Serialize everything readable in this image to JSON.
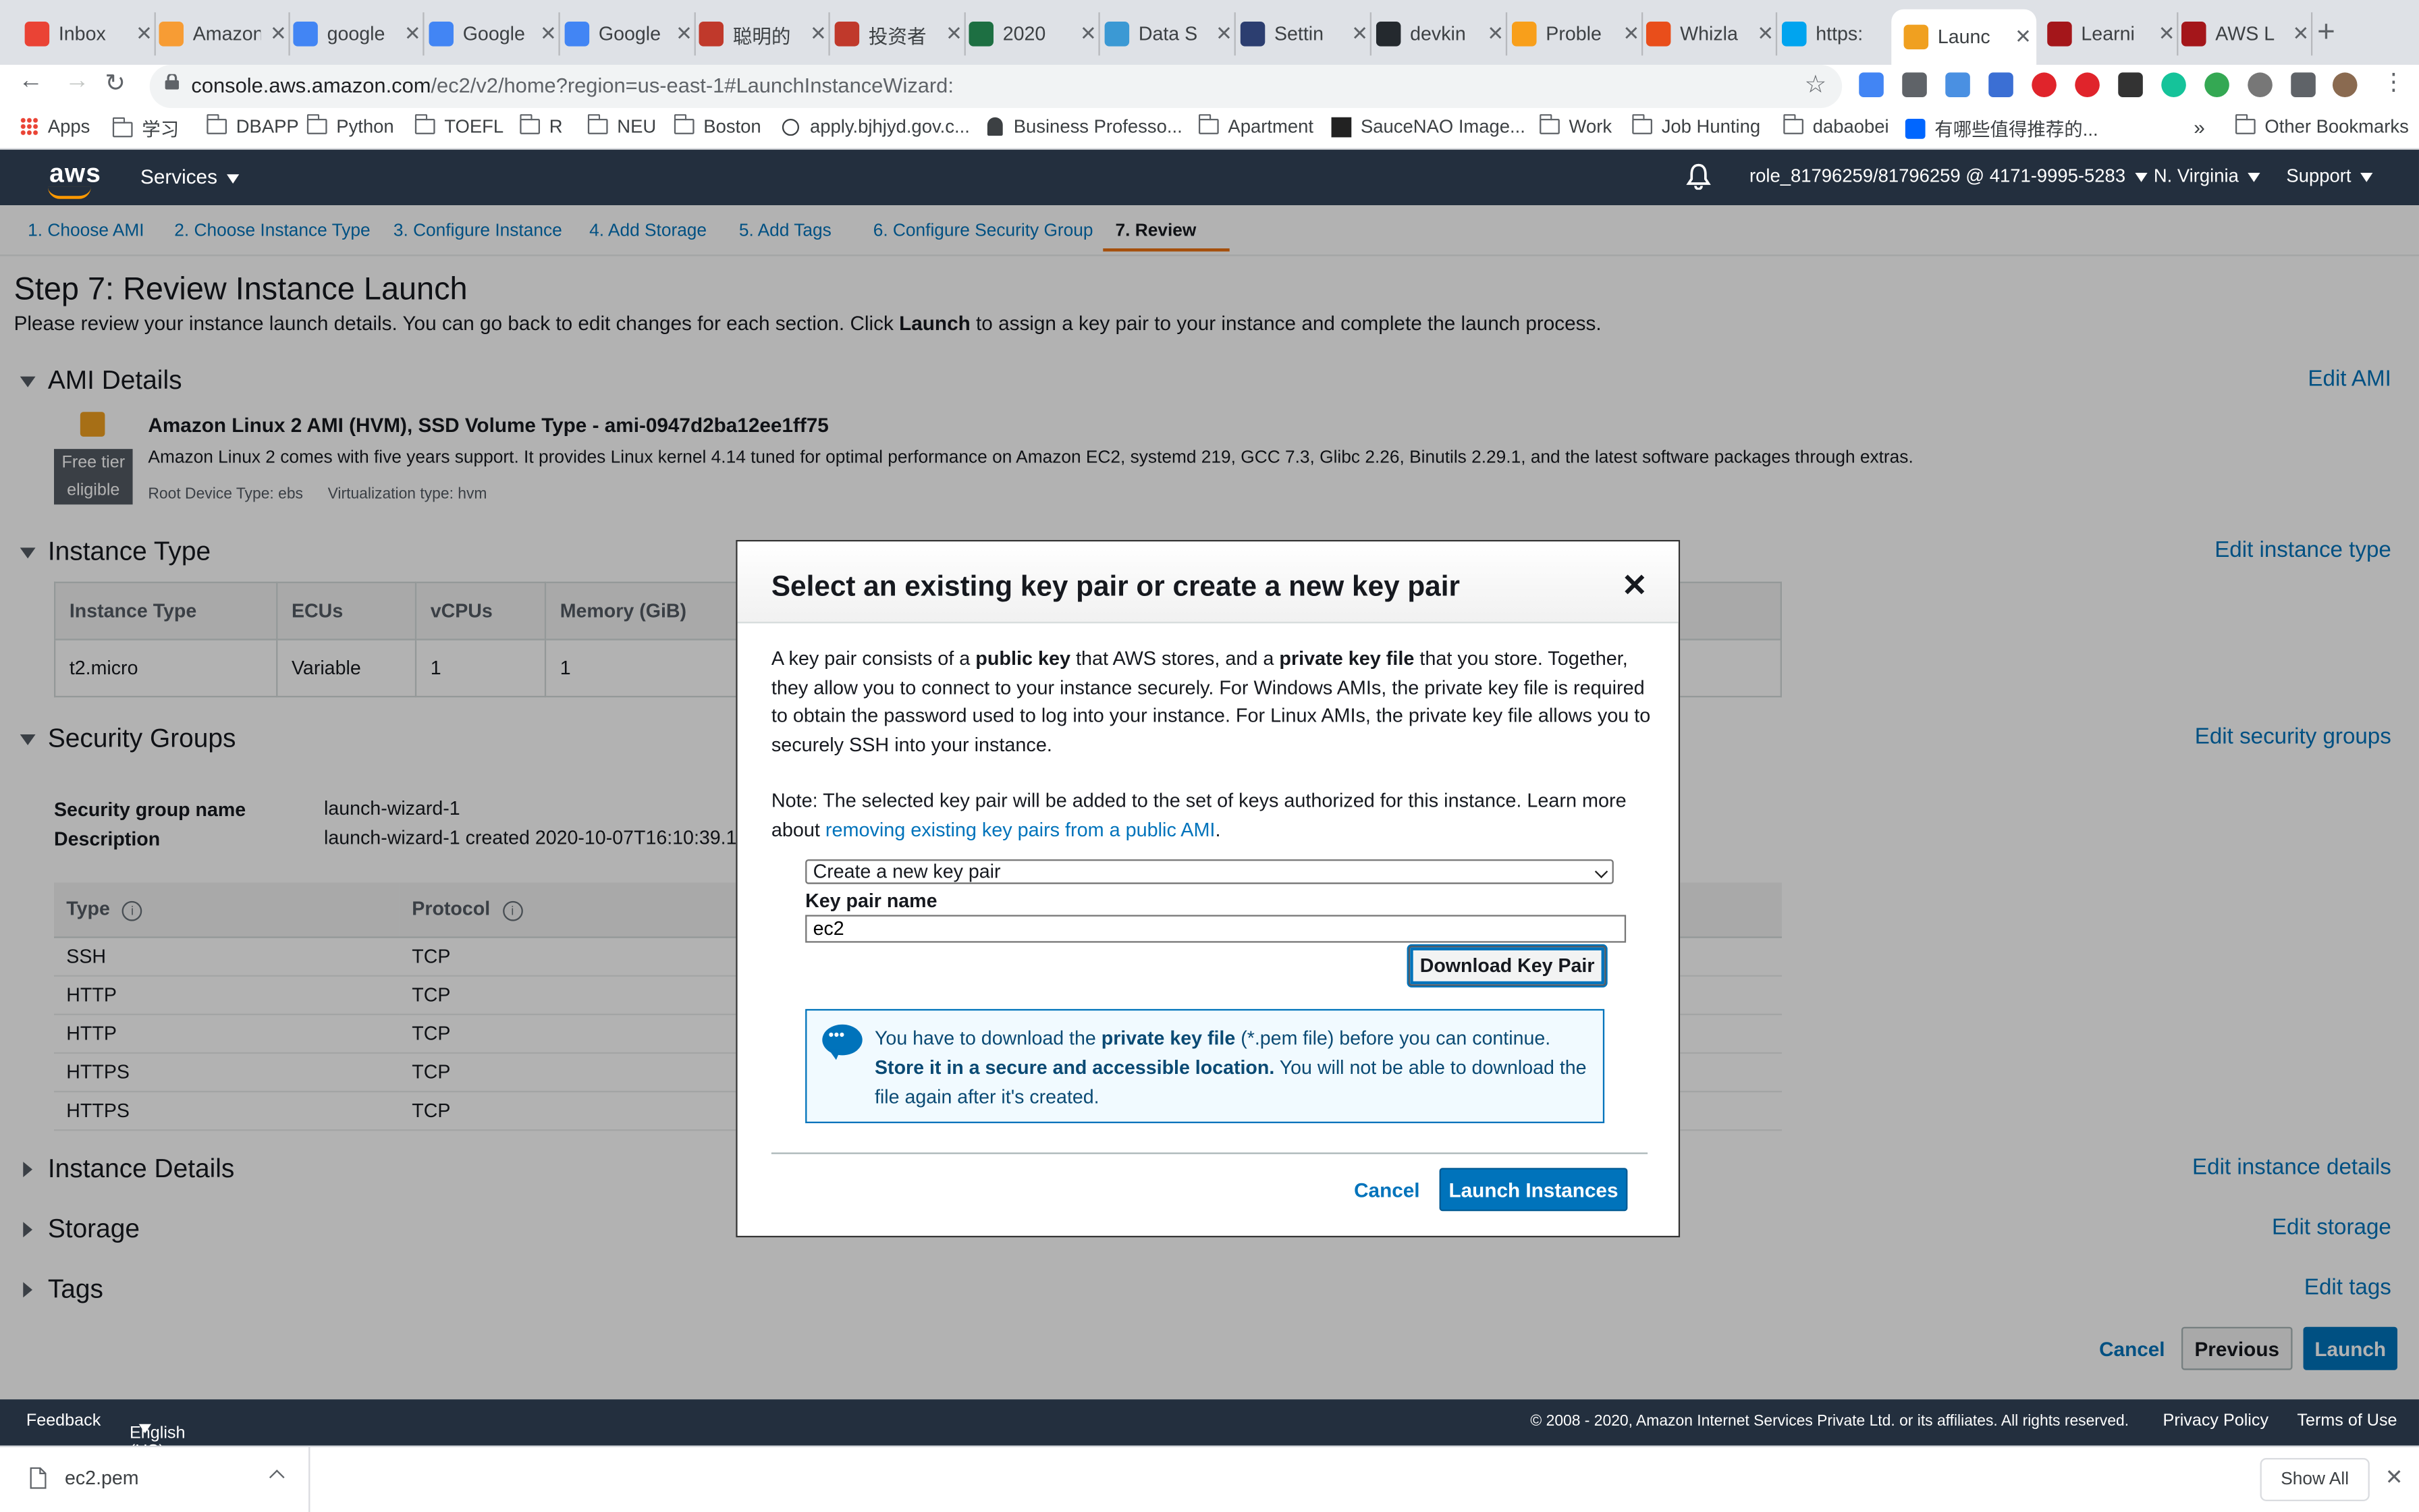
{
  "browser": {
    "tabs": [
      {
        "title": "Inbox",
        "icon": "gmail-icon",
        "color": "#ea4335"
      },
      {
        "title": "Amazon",
        "icon": "amazon-icon",
        "color": "#f79c34"
      },
      {
        "title": "google",
        "icon": "google-icon",
        "color": "#4285f4"
      },
      {
        "title": "Google",
        "icon": "google-translate-icon",
        "color": "#4285f4"
      },
      {
        "title": "Google",
        "icon": "google-translate-icon",
        "color": "#4285f4"
      },
      {
        "title": "聪明的",
        "icon": "bear-icon",
        "color": "#c0392b"
      },
      {
        "title": "投资者",
        "icon": "bear-icon",
        "color": "#c0392b"
      },
      {
        "title": "2020",
        "icon": "excel-icon",
        "color": "#1d6f42"
      },
      {
        "title": "Data S",
        "icon": "shield-icon",
        "color": "#3b99d4"
      },
      {
        "title": "Settin",
        "icon": "settings-icon",
        "color": "#2c3e70"
      },
      {
        "title": "devkin",
        "icon": "github-icon",
        "color": "#24292e"
      },
      {
        "title": "Proble",
        "icon": "leetcode-icon",
        "color": "#f89f1b"
      },
      {
        "title": "Whizla",
        "icon": "whizlabs-icon",
        "color": "#e94e1b"
      },
      {
        "title": "https:",
        "icon": "microsoft-icon",
        "color": "#00a4ef"
      },
      {
        "title": "Launc",
        "icon": "aws-cube-icon",
        "color": "#f0a020",
        "active": true
      },
      {
        "title": "Learni",
        "icon": "udemy-icon",
        "color": "#a4161a"
      },
      {
        "title": "AWS L",
        "icon": "udemy-icon",
        "color": "#a4161a"
      }
    ],
    "url_host": "console.aws.amazon.com",
    "url_path": "/ec2/v2/home?region=us-east-1#LaunchInstanceWizard:",
    "bookmarks": [
      "Apps",
      "学习",
      "DBAPP",
      "Python",
      "TOEFL",
      "R",
      "NEU",
      "Boston",
      "apply.bjhjyd.gov.c...",
      "Business Professo...",
      "Apartment",
      "SauceNAO Image...",
      "Work",
      "Job Hunting",
      "dabaobei",
      "有哪些值得推荐的..."
    ],
    "bookmarks_more": "»",
    "other_bookmarks": "Other Bookmarks"
  },
  "aws_header": {
    "logo": "aws",
    "services": "Services",
    "account": "role_81796259/81796259 @ 4171-9995-5283",
    "region": "N. Virginia",
    "support": "Support"
  },
  "wizard_steps": [
    "1. Choose AMI",
    "2. Choose Instance Type",
    "3. Configure Instance",
    "4. Add Storage",
    "5. Add Tags",
    "6. Configure Security Group",
    "7. Review"
  ],
  "page": {
    "title": "Step 7: Review Instance Launch",
    "intro_a": "Please review your instance launch details. You can go back to edit changes for each section. Click ",
    "intro_b": "Launch",
    "intro_c": " to assign a key pair to your instance and complete the launch process."
  },
  "ami": {
    "heading": "AMI Details",
    "edit": "Edit AMI",
    "free_tier_1": "Free tier",
    "free_tier_2": "eligible",
    "name": "Amazon Linux 2 AMI (HVM), SSD Volume Type - ami-0947d2ba12ee1ff75",
    "description": "Amazon Linux 2 comes with five years support. It provides Linux kernel 4.14 tuned for optimal performance on Amazon EC2, systemd 219, GCC 7.3, Glibc 2.26, Binutils 2.29.1, and the latest software packages through extras.",
    "root_device": "Root Device Type: ebs",
    "virtualization": "Virtualization type: hvm"
  },
  "instance_type": {
    "heading": "Instance Type",
    "edit": "Edit instance type",
    "headers": [
      "Instance Type",
      "ECUs",
      "vCPUs",
      "Memory (GiB)"
    ],
    "row": [
      "t2.micro",
      "Variable",
      "1",
      "1"
    ]
  },
  "security_groups": {
    "heading": "Security Groups",
    "edit": "Edit security groups",
    "name_label": "Security group name",
    "name_value": "launch-wizard-1",
    "desc_label": "Description",
    "desc_value": "launch-wizard-1 created 2020-10-07T16:10:39.1",
    "headers": [
      "Type",
      "Protocol"
    ],
    "rules": [
      [
        "SSH",
        "TCP"
      ],
      [
        "HTTP",
        "TCP"
      ],
      [
        "HTTP",
        "TCP"
      ],
      [
        "HTTPS",
        "TCP"
      ],
      [
        "HTTPS",
        "TCP"
      ]
    ]
  },
  "collapsed_sections": [
    {
      "heading": "Instance Details",
      "edit": "Edit instance details"
    },
    {
      "heading": "Storage",
      "edit": "Edit storage"
    },
    {
      "heading": "Tags",
      "edit": "Edit tags"
    }
  ],
  "page_actions": {
    "cancel": "Cancel",
    "previous": "Previous",
    "launch": "Launch"
  },
  "footer": {
    "feedback": "Feedback",
    "language": "English (US)",
    "copyright": "© 2008 - 2020, Amazon Internet Services Private Ltd. or its affiliates. All rights reserved.",
    "privacy": "Privacy Policy",
    "terms": "Terms of Use"
  },
  "download_bar": {
    "file": "ec2.pem",
    "show_all": "Show All"
  },
  "modal": {
    "title": "Select an existing key pair or create a new key pair",
    "close": "✕",
    "p1_a": "A key pair consists of a ",
    "p1_b": "public key",
    "p1_c": " that AWS stores, and a ",
    "p1_d": "private key file",
    "p1_e": " that you store. Together, they allow you to connect to your instance securely. For Windows AMIs, the private key file is required to obtain the password used to log into your instance. For Linux AMIs, the private key file allows you to securely SSH into your instance.",
    "p2_a": "Note: The selected key pair will be added to the set of keys authorized for this instance. Learn more about ",
    "p2_link": "removing existing key pairs from a public AMI",
    "p2_b": ".",
    "select_value": "Create a new key pair",
    "key_pair_label": "Key pair name",
    "key_pair_value": "ec2",
    "download_button": "Download Key Pair",
    "notice_a": "You have to download the ",
    "notice_b": "private key file",
    "notice_c": " (*.pem file) before you can continue. ",
    "notice_d": "Store it in a secure and accessible location.",
    "notice_e": " You will not be able to download the file again after it's created.",
    "cancel": "Cancel",
    "launch": "Launch Instances"
  },
  "colors": {
    "aws_dark": "#232f3e",
    "link_blue": "#0073bb",
    "aws_orange": "#ec7211",
    "primary_button": "#0073bb"
  }
}
